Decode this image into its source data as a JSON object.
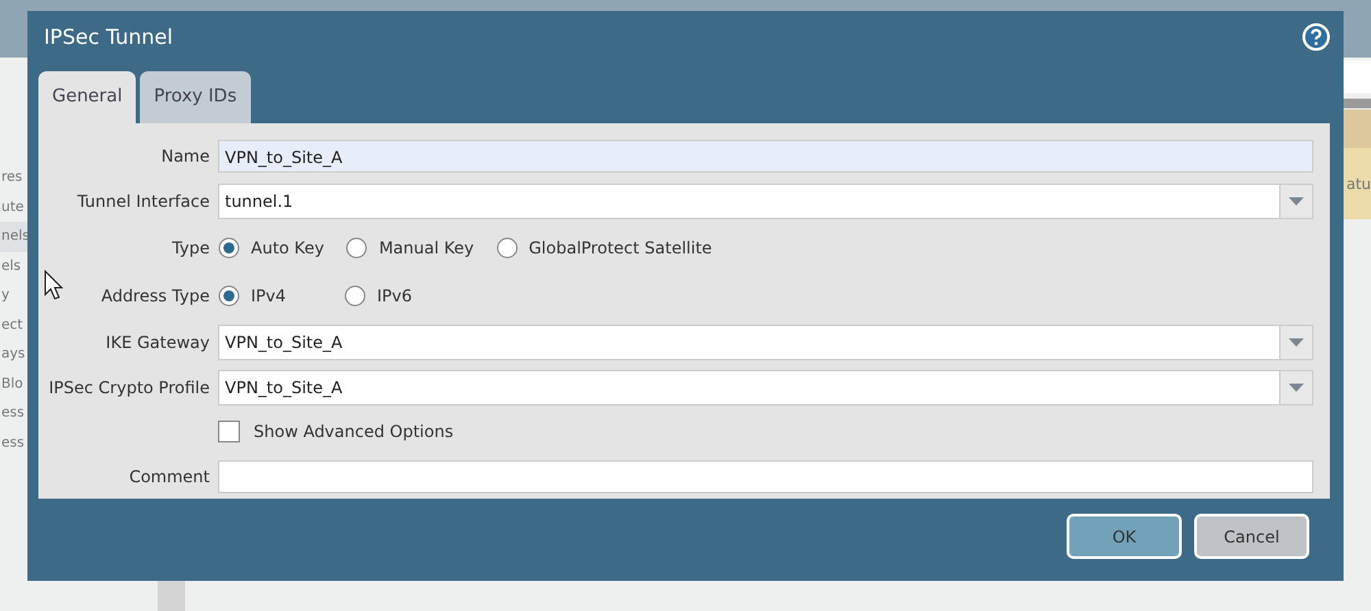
{
  "background": {
    "sidebar_items": [
      {
        "label": "res",
        "selected": false
      },
      {
        "label": "ute",
        "selected": false
      },
      {
        "label": "nels",
        "selected": true
      },
      {
        "label": "els",
        "selected": false
      },
      {
        "label": "y",
        "selected": false
      },
      {
        "label": "ect",
        "selected": false
      },
      {
        "label": "ays",
        "selected": false
      },
      {
        "label": "Blo",
        "selected": false
      },
      {
        "label": "ess",
        "selected": false
      },
      {
        "label": "ess",
        "selected": false
      }
    ],
    "table_fragment": "atu"
  },
  "dialog": {
    "title": "IPSec Tunnel",
    "tabs": [
      {
        "label": "General",
        "selected": true
      },
      {
        "label": "Proxy IDs",
        "selected": false
      }
    ],
    "fields": [
      {
        "kind": "text",
        "label": "Name",
        "value": "VPN_to_Site_A",
        "focused": true
      },
      {
        "kind": "select",
        "label": "Tunnel Interface",
        "value": "tunnel.1"
      },
      {
        "kind": "radio",
        "label": "Type",
        "options": [
          {
            "label": "Auto Key",
            "selected": true
          },
          {
            "label": "Manual Key",
            "selected": false
          },
          {
            "label": "GlobalProtect Satellite",
            "selected": false
          }
        ]
      },
      {
        "kind": "radio",
        "label": "Address Type",
        "options": [
          {
            "label": "IPv4",
            "selected": true
          },
          {
            "label": "IPv6",
            "selected": false
          }
        ]
      },
      {
        "kind": "select",
        "label": "IKE Gateway",
        "value": "VPN_to_Site_A"
      },
      {
        "kind": "select",
        "label": "IPSec Crypto Profile",
        "value": "VPN_to_Site_A"
      },
      {
        "kind": "checkbox",
        "label": "Show Advanced Options",
        "checked": false
      },
      {
        "kind": "text",
        "label": "Comment",
        "focused": false
      }
    ],
    "buttons": [
      {
        "label": "OK",
        "kind": "primary"
      },
      {
        "label": "Cancel",
        "kind": "secondary"
      }
    ]
  }
}
